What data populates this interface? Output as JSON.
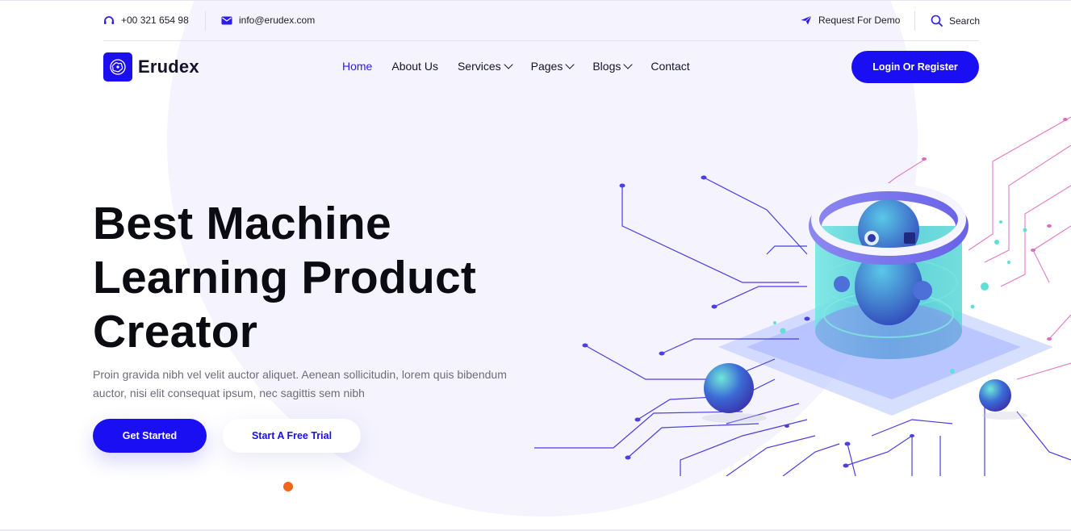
{
  "topbar": {
    "phone": "+00 321 654 98",
    "email": "info@erudex.com",
    "demo": "Request For Demo",
    "search": "Search"
  },
  "brand": {
    "name": "Erudex"
  },
  "nav": {
    "items": [
      {
        "label": "Home",
        "active": true
      },
      {
        "label": "About Us"
      },
      {
        "label": "Services",
        "dropdown": true
      },
      {
        "label": "Pages",
        "dropdown": true
      },
      {
        "label": "Blogs",
        "dropdown": true
      },
      {
        "label": "Contact"
      }
    ],
    "login": "Login Or Register"
  },
  "hero": {
    "title_line1": "Best Machine",
    "title_line2": "Learning Product",
    "title_line3": "Creator",
    "description": "Proin gravida nibh vel velit auctor aliquet. Aenean sollicitudin, lorem quis bibendum auctor, nisi elit consequat ipsum, nec sagittis sem nibh",
    "cta_primary": "Get Started",
    "cta_secondary": "Start A Free Trial"
  },
  "colors": {
    "accent": "#1a0ff2",
    "slider_dot": "#f0661a",
    "circuit_blue": "#4a3fe0",
    "circuit_pink": "#e06ac0",
    "teal": "#5ee0d8"
  },
  "icons": {
    "phone": "headphones-icon",
    "email": "envelope-icon",
    "demo": "paper-plane-icon",
    "search": "search-icon",
    "logo": "brain-icon"
  }
}
